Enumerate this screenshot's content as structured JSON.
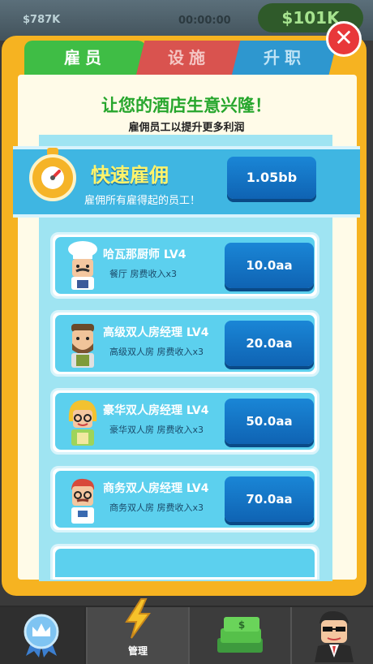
{
  "hud": {
    "money_left": "$787K",
    "timer": "00:00:00",
    "money": "$101K"
  },
  "tabs": [
    {
      "label": "雇员"
    },
    {
      "label": "设施"
    },
    {
      "label": "升职"
    }
  ],
  "header": {
    "title": "让您的酒店生意兴隆！",
    "subtitle": "雇佣员工以提升更多利润"
  },
  "fast_hire": {
    "title": "快速雇佣",
    "description": "雇佣所有雇得起的员工！",
    "price": "1.05bb"
  },
  "employees": [
    {
      "name": "哈瓦那厨师 LV4",
      "location": "餐厅",
      "effect": "房费收入x3",
      "price": "10.0aa",
      "icon": "chef-avatar-icon"
    },
    {
      "name": "高级双人房经理 LV4",
      "location": "高级双人房",
      "effect": "房费收入x3",
      "price": "20.0aa",
      "icon": "bearded-manager-avatar-icon"
    },
    {
      "name": "豪华双人房经理 LV4",
      "location": "豪华双人房",
      "effect": "房费收入x3",
      "price": "50.0aa",
      "icon": "blonde-manager-avatar-icon"
    },
    {
      "name": "商务双人房经理 LV4",
      "location": "商务双人房",
      "effect": "房费收入x3",
      "price": "70.0aa",
      "icon": "redhair-manager-avatar-icon"
    }
  ],
  "nav": [
    {
      "label": "",
      "icon": "crown-badge-icon"
    },
    {
      "label": "管理",
      "icon": "lightning-icon"
    },
    {
      "label": "",
      "icon": "money-stack-icon"
    },
    {
      "label": "",
      "icon": "boss-avatar-icon"
    }
  ],
  "colors": {
    "frame": "#f6b321",
    "active_tab": "#3fbd45",
    "button": "#1a86d6",
    "banner": "#3fb6e2"
  }
}
